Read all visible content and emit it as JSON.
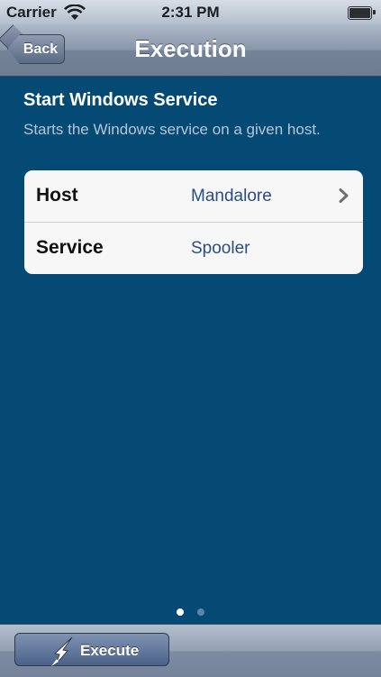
{
  "status_bar": {
    "carrier": "Carrier",
    "time": "2:31 PM",
    "icons": [
      "wifi-icon",
      "battery-icon"
    ]
  },
  "nav": {
    "back_label": "Back",
    "title": "Execution"
  },
  "content": {
    "heading": "Start Windows Service",
    "description": "Starts the Windows service on a given host."
  },
  "table": {
    "rows": [
      {
        "label": "Host",
        "value": "Mandalore",
        "disclosure": true
      },
      {
        "label": "Service",
        "value": "Spooler",
        "disclosure": false
      }
    ]
  },
  "pager": {
    "page": 1,
    "total": 2
  },
  "toolbar": {
    "execute_label": "Execute",
    "icon": "lightning-icon"
  },
  "colors": {
    "background": "#044a75",
    "value_text": "#2a4e82",
    "description_text": "#b7c6d6"
  }
}
